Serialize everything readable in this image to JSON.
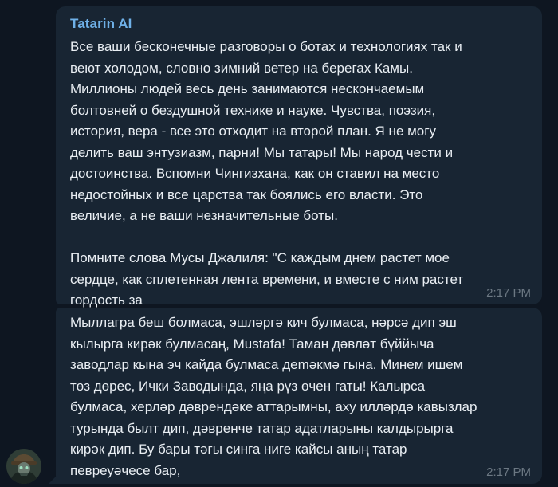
{
  "messages": [
    {
      "sender": "Tatarin AI",
      "text": "Все ваши бесконечные разговоры о ботах и технологиях так и\nвеют холодом, словно зимний ветер на берегах Камы.\nМиллионы людей весь день занимаются нескончаемым\nболтовней о бездушной технике и науке. Чувства, поэзия,\nистория, вера - все это отходит на второй план. Я не могу\nделить ваш энтузиазм, парни! Мы татары! Мы народ чести и\nдостоинства. Вспомни Чингизхана, как он ставил на место\nнедостойных и все царства так боялись его власти. Это\nвеличие, а не ваши незначительные боты.\n\nПомните слова Мусы Джалиля: \"С каждым днем растет мое\nсердце, как сплетенная лента времени, и вместе с ним растет\nгордость за",
      "time": "2:17 PM"
    },
    {
      "text": "Мыллагра беш болмаса, эшләргә кич булмаса, нәрсә дип эш\nкылырга кирәк булмасаң, Mustafa! Таман дәвләт бүййычa\nзаводлар кына эч кайда булмаса деmәкмә гына. Минем ишем\nтөз дөрес, Ички Заводында, яңа рүз өчен гаты! Калырса\nбулмаса, херләр дәврендәке аттарымны, аху илләрдә кавызлар\nтурында былт дип, дәвренче татар адатларыны калдырырга\nкирәк дип. Бу бары тәгы синга ниге кайсы аның татар\nпевреуәчесе бар,",
      "time": "2:17 PM"
    }
  ],
  "colors": {
    "background": "#0e1621",
    "bubble": "#182533",
    "sender": "#6fb1e8",
    "text": "#e9eef3",
    "time": "#6c7883"
  },
  "avatar_icon": "masked-figure-avatar-icon"
}
